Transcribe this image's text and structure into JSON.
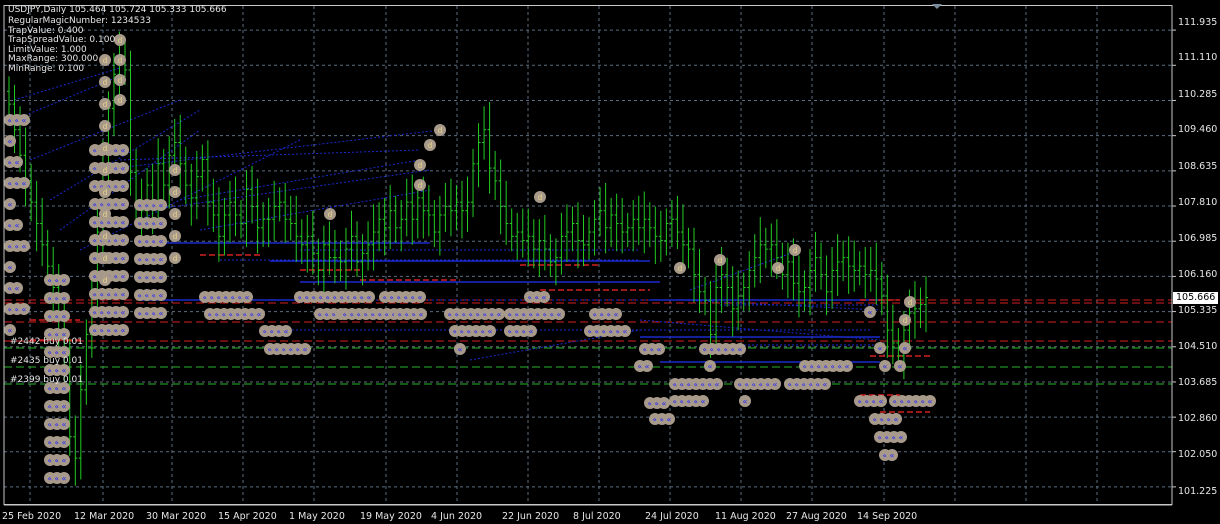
{
  "window": {
    "symbol_line": "USDJPY,Daily  105.464 105.724 105.333 105.666",
    "info_lines": [
      "RegularMagicNumber: 1234533",
      "TrapValue: 0.400",
      "TrapSpreadValue: 0.100",
      "LimitValue: 1.000",
      "MaxRange: 300.000",
      "MinRange: 0.100"
    ]
  },
  "price_axis": {
    "labels": [
      "111.935",
      "111.110",
      "110.285",
      "109.460",
      "108.635",
      "107.810",
      "106.985",
      "106.160",
      "105.335",
      "104.510",
      "103.685",
      "102.860",
      "102.050",
      "101.225"
    ],
    "current_price": "105.666"
  },
  "time_axis": {
    "labels": [
      "25 Feb 2020",
      "12 Mar 2020",
      "30 Mar 2020",
      "15 Apr 2020",
      "1 May 2020",
      "19 May 2020",
      "4 Jun 2020",
      "22 Jun 2020",
      "8 Jul 2020",
      "24 Jul 2020",
      "11 Aug 2020",
      "27 Aug 2020",
      "14 Sep 2020"
    ]
  },
  "order_labels": [
    {
      "text": "#2442 buy 0.01"
    },
    {
      "text": "#2435 buy 0.01"
    },
    {
      "text": "#2399 buy 0.01"
    }
  ],
  "colors": {
    "background": "#000000",
    "grid": "#5b6e80",
    "candle_up": "#22cc22",
    "candle_down": "#22cc22",
    "marker_fill": "#a89a8a",
    "marker_glyph": "#2323ff",
    "marker_glyph_alt": "#e6d28a",
    "order_line_red": "#d42020",
    "order_line_green": "#28b428",
    "blue_line": "#1a2acc"
  },
  "chart_data": {
    "type": "candlestick",
    "symbol": "USDJPY",
    "timeframe": "Daily",
    "last_bar": {
      "open": 105.464,
      "high": 105.724,
      "low": 105.333,
      "close": 105.666
    },
    "ylim": [
      100.8,
      112.5
    ],
    "x_tick_labels": [
      "25 Feb 2020",
      "12 Mar 2020",
      "30 Mar 2020",
      "15 Apr 2020",
      "1 May 2020",
      "19 May 2020",
      "4 Jun 2020",
      "22 Jun 2020",
      "8 Jul 2020",
      "24 Jul 2020",
      "11 Aug 2020",
      "27 Aug 2020",
      "14 Sep 2020"
    ],
    "y_tick_labels": [
      111.935,
      111.11,
      110.285,
      109.46,
      108.635,
      107.81,
      106.985,
      106.16,
      105.335,
      104.51,
      103.685,
      102.86,
      102.05,
      101.225
    ],
    "closes": [
      110.2,
      109.6,
      109.0,
      108.4,
      107.9,
      107.4,
      106.9,
      106.4,
      105.9,
      104.9,
      104.3,
      102.4,
      101.9,
      103.5,
      104.8,
      105.7,
      107.2,
      108.7,
      110.1,
      110.9,
      111.3,
      111.0,
      108.6,
      107.8,
      107.7,
      108.3,
      107.8,
      108.8,
      108.3,
      109.0,
      109.3,
      108.8,
      108.3,
      108.0,
      108.5,
      108.9,
      107.9,
      107.6,
      107.1,
      107.6,
      107.9,
      107.6,
      107.4,
      108.2,
      107.8,
      107.3,
      107.5,
      107.5,
      107.8,
      107.9,
      107.5,
      107.4,
      107.1,
      106.9,
      107.1,
      106.7,
      106.3,
      106.9,
      106.6,
      106.6,
      106.5,
      106.8,
      107.1,
      106.5,
      106.7,
      106.9,
      107.2,
      107.5,
      107.3,
      107.7,
      107.3,
      107.5,
      107.9,
      107.5,
      108.0,
      107.7,
      107.6,
      107.2,
      107.6,
      107.8,
      107.7,
      107.9,
      107.7,
      107.9,
      108.8,
      109.3,
      109.6,
      108.7,
      108.4,
      107.8,
      107.4,
      107.1,
      107.2,
      107.0,
      107.1,
      106.8,
      107.0,
      106.8,
      106.5,
      106.6,
      107.1,
      107.2,
      107.4,
      107.0,
      106.9,
      107.2,
      107.5,
      107.7,
      107.3,
      107.6,
      107.4,
      107.2,
      107.3,
      107.5,
      107.3,
      107.5,
      107.3,
      107.1,
      107.0,
      107.4,
      107.5,
      107.2,
      106.9,
      106.8,
      106.2,
      105.8,
      105.6,
      104.8,
      105.9,
      106.2,
      105.9,
      105.4,
      105.7,
      105.9,
      106.3,
      106.6,
      106.9,
      106.8,
      106.9,
      106.6,
      106.2,
      106.5,
      106.0,
      105.8,
      105.9,
      106.3,
      106.6,
      106.2,
      105.8,
      106.3,
      106.5,
      106.6,
      106.4,
      106.3,
      106.4,
      106.2,
      106.3,
      106.1,
      105.7,
      104.9,
      104.6,
      104.3,
      104.9,
      105.3,
      105.4,
      105.5,
      105.666
    ]
  }
}
